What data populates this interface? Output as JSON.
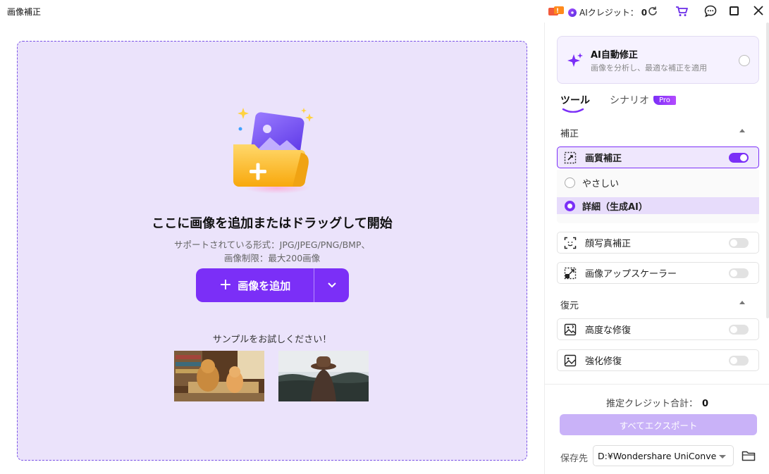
{
  "titlebar": {
    "app_title": "画像補正",
    "credit_label": "AIクレジット：",
    "credit_value": "0",
    "icons": [
      "notification-badge-icon",
      "credit-icon",
      "refresh-icon",
      "cart-icon",
      "chat-icon",
      "maximize-icon",
      "close-icon"
    ]
  },
  "dropzone": {
    "title": "ここに画像を追加またはドラッグして開始",
    "formats": "サポートされている形式：JPG/JPEG/PNG/BMP、",
    "limit": "画像制限：最大200画像",
    "add_button": "画像を追加",
    "sample_label": "サンプルをお試しください！",
    "accent_color": "#7b2ff7",
    "background_color": "#ebe3fb"
  },
  "panel": {
    "auto": {
      "title": "AI自動修正",
      "desc": "画像を分析し、最適な補正を適用"
    },
    "tabs": [
      {
        "label": "ツール",
        "active": true
      },
      {
        "label": "シナリオ",
        "badge": "Pro",
        "active": false
      }
    ],
    "sections": {
      "correction": "補正",
      "restore": "復元"
    },
    "tools": {
      "quality": {
        "label": "画質補正",
        "on": true
      },
      "face": {
        "label": "顔写真補正",
        "on": false
      },
      "upscale": {
        "label": "画像アップスケーラー",
        "on": false
      },
      "advanced_restore": {
        "label": "高度な修復",
        "on": false
      },
      "enhance_restore": {
        "label": "強化修復",
        "on": false
      }
    },
    "quality_options": [
      {
        "label": "やさしい",
        "selected": false
      },
      {
        "label": "詳細（生成AI）",
        "selected": true
      }
    ],
    "estimate_label": "推定クレジット合計：",
    "estimate_value": "0",
    "export_button": "すべてエクスポート",
    "save_label": "保存先",
    "save_path": "D:¥Wondershare UniConve"
  }
}
